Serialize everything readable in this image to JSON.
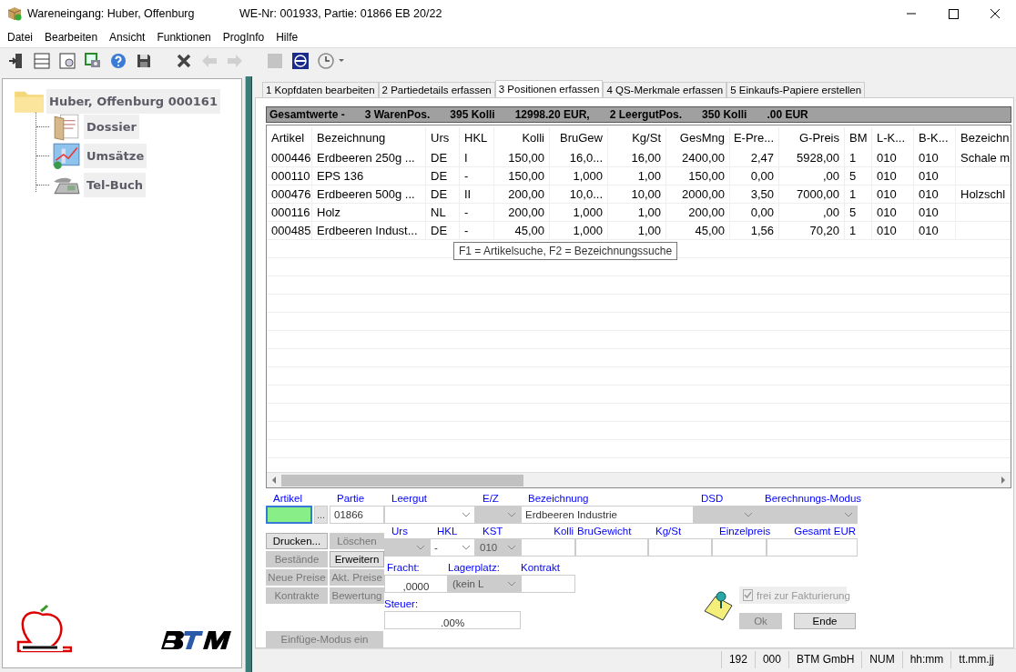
{
  "window": {
    "title": "Wareneingang: Huber, Offenburg",
    "subtitle": "WE-Nr: 001933, Partie: 01866 EB 20/22"
  },
  "menu": [
    "Datei",
    "Bearbeiten",
    "Ansicht",
    "Funktionen",
    "ProgInfo",
    "Hilfe"
  ],
  "toolbar": [
    {
      "kind": "exit",
      "disabled": false
    },
    {
      "kind": "form",
      "disabled": false
    },
    {
      "kind": "preview",
      "disabled": false
    },
    {
      "kind": "camera",
      "disabled": false
    },
    {
      "kind": "help",
      "disabled": false
    },
    {
      "kind": "save",
      "disabled": false
    },
    {
      "kind": "delete",
      "disabled": false
    },
    {
      "kind": "back",
      "disabled": true
    },
    {
      "kind": "forward",
      "disabled": true
    },
    {
      "kind": "stop",
      "disabled": true
    },
    {
      "kind": "emblem",
      "disabled": false
    },
    {
      "kind": "clock",
      "disabled": false
    }
  ],
  "tree": {
    "label": "Huber, Offenburg 000161",
    "kind": "folder",
    "children": [
      {
        "label": "Dossier",
        "kind": "documents"
      },
      {
        "label": "Umsätze",
        "kind": "chart"
      },
      {
        "label": "Tel-Buch",
        "kind": "telephone"
      }
    ]
  },
  "tabs": [
    {
      "label": "1 Kopfdaten bearbeiten",
      "selected": false
    },
    {
      "label": "2 Partiedetails erfassen",
      "selected": false
    },
    {
      "label": "3 Positionen erfassen",
      "selected": true
    },
    {
      "label": "4 QS-Merkmale erfassen",
      "selected": false
    },
    {
      "label": "5 Einkaufs-Papiere erstellen",
      "selected": false
    }
  ],
  "totals": [
    "Gesamtwerte -",
    "3 WarenPos.",
    "395 Kolli",
    "12998.20 EUR,",
    "2 LeergutPos.",
    "350 Kolli",
    ".00 EUR"
  ],
  "table": {
    "columns": [
      "Artikel",
      "Bezeichnung",
      "Urs",
      "HKL",
      "Kolli",
      "BruGew",
      "Kg/St",
      "GesMng",
      "E-Pre...",
      "G-Preis",
      "BM",
      "L-K...",
      "B-K...",
      "Bezeichn"
    ],
    "rows": [
      [
        "000446",
        "Erdbeeren 250g ...",
        "DE",
        "I",
        "150,00",
        "16,0...",
        "16,00",
        "2400,00",
        "2,47",
        "5928,00",
        "1",
        "010",
        "010",
        "Schale m"
      ],
      [
        "000110",
        "EPS 136",
        "DE",
        "-",
        "150,00",
        "1,000",
        "1,00",
        "150,00",
        "0,00",
        ",00",
        "5",
        "010",
        "010",
        ""
      ],
      [
        "000476",
        "Erdbeeren 500g ...",
        "DE",
        "II",
        "200,00",
        "10,0...",
        "10,00",
        "2000,00",
        "3,50",
        "7000,00",
        "1",
        "010",
        "010",
        "Holzschl"
      ],
      [
        "000116",
        "Holz",
        "NL",
        "-",
        "200,00",
        "1,000",
        "1,00",
        "200,00",
        "0,00",
        ",00",
        "5",
        "010",
        "010",
        ""
      ],
      [
        "000485",
        "Erdbeeren Indust...",
        "DE",
        "-",
        "45,00",
        "1,000",
        "1,00",
        "45,00",
        "1,56",
        "70,20",
        "1",
        "010",
        "010",
        ""
      ]
    ]
  },
  "tooltip": "F1 = Artikelsuche, F2 = Bezeichnungssuche",
  "form": {
    "top": [
      {
        "label": "Artikel",
        "kind": "current",
        "disabled": false
      },
      {
        "kind": "button",
        "value": "...",
        "disabled": false
      },
      {
        "label": "Partie",
        "kind": "input",
        "value": "01866",
        "disabled": false
      },
      {
        "label": "Leergut",
        "kind": "select",
        "disabled": false
      },
      {
        "label": "E/Z",
        "kind": "select",
        "disabled": true
      },
      {
        "label": "Bezeichnung",
        "kind": "input",
        "value": "Erdbeeren Industrie",
        "disabled": false
      },
      {
        "label": "DSD",
        "kind": "select",
        "disabled": true
      },
      {
        "label": "Berechnungs-Modus",
        "kind": "select",
        "disabled": true
      }
    ],
    "middle": [
      {
        "label": "Urs",
        "kind": "select",
        "disabled": true
      },
      {
        "label": "HKL",
        "kind": "select",
        "value": "-",
        "disabled": false
      },
      {
        "label": "KST",
        "kind": "select",
        "value": "010",
        "disabled": true
      },
      {
        "label": "Kolli",
        "kind": "input",
        "disabled": false
      },
      {
        "label": "BruGewicht",
        "kind": "input",
        "disabled": false
      },
      {
        "label": "Kg/St",
        "kind": "input",
        "disabled": false
      },
      {
        "label": "Einzelpreis",
        "kind": "input",
        "disabled": false
      },
      {
        "label": "Gesamt EUR",
        "kind": "input",
        "disabled": false
      }
    ],
    "lower": [
      {
        "label": "Fracht:",
        "kind": "input",
        "value": ",0000",
        "disabled": false
      },
      {
        "label": "Lagerplatz:",
        "kind": "select",
        "value": "(kein L",
        "disabled": true
      },
      {
        "label": "Kontrakt",
        "kind": "input",
        "disabled": false
      }
    ],
    "tax": {
      "label": "Steuer:",
      "value": ".00%"
    },
    "buttons": [
      {
        "label": "Drucken...",
        "disabled": false
      },
      {
        "label": "Löschen",
        "disabled": true
      },
      {
        "label": "Bestände",
        "disabled": true
      },
      {
        "label": "Erweitern",
        "disabled": false
      },
      {
        "label": "Neue Preise",
        "disabled": true
      },
      {
        "label": "Akt. Preise",
        "disabled": true
      },
      {
        "label": "Kontrakte",
        "disabled": true
      },
      {
        "label": "Bewertung",
        "disabled": true
      }
    ],
    "insert_button": {
      "label": "Einfüge-Modus ein",
      "disabled": true
    },
    "invoice_check": {
      "label": "frei zur Fakturierung",
      "checked": true,
      "disabled": true
    },
    "ok": {
      "label": "Ok",
      "disabled": true
    },
    "end": {
      "label": "Ende",
      "disabled": false
    }
  },
  "status_bar": [
    "192",
    "000",
    "BTM GmbH",
    "NUM",
    "hh:mm",
    "tt.mm.jj"
  ]
}
